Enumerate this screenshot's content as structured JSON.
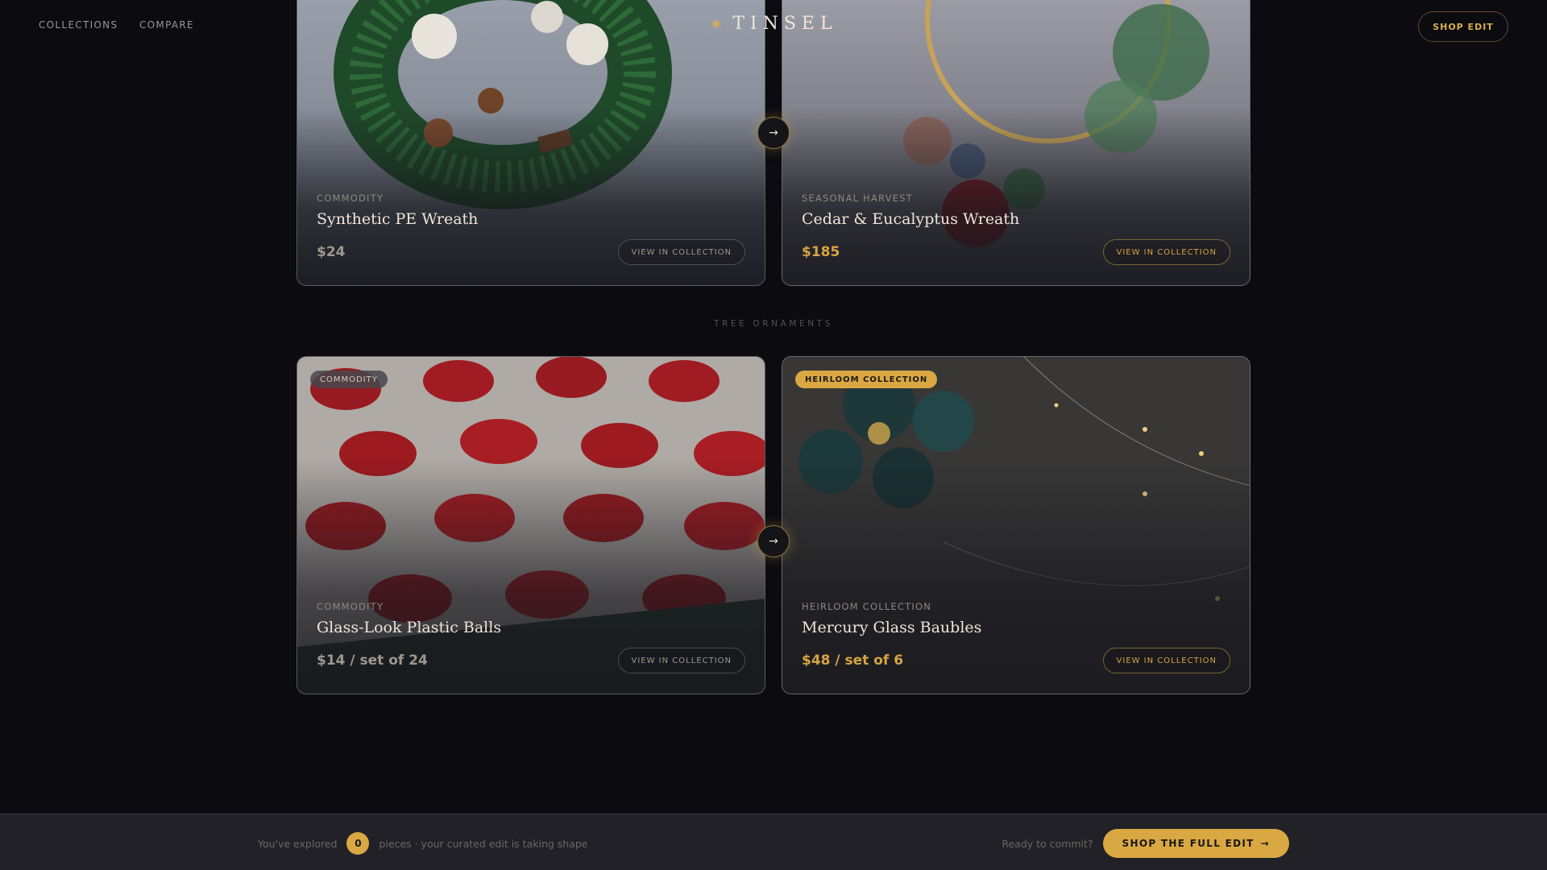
{
  "header": {
    "nav": [
      "COLLECTIONS",
      "COMPARE"
    ],
    "brand_icon": "star-icon",
    "brand_name": "TINSEL",
    "shop_edit_label": "SHOP EDIT",
    "accent_color": "#d9a843"
  },
  "wreaths": {
    "commodity": {
      "category": "COMMODITY",
      "title": "Synthetic PE Wreath",
      "price": "$24",
      "cta": "VIEW IN COLLECTION"
    },
    "heirloom": {
      "category": "SEASONAL HARVEST",
      "title": "Cedar & Eucalyptus Wreath",
      "price": "$185",
      "cta": "VIEW IN COLLECTION"
    },
    "compare_icon": "arrow-right-icon"
  },
  "ornaments": {
    "section_label": "TREE ORNAMENTS",
    "commodity": {
      "badge": "COMMODITY",
      "category": "COMMODITY",
      "title": "Glass-Look Plastic Balls",
      "price": "$14 / set of 24",
      "cta": "VIEW IN COLLECTION"
    },
    "heirloom": {
      "badge": "HEIRLOOM COLLECTION",
      "category": "HEIRLOOM COLLECTION",
      "title": "Mercury Glass Baubles",
      "price": "$48 / set of 6",
      "cta": "VIEW IN COLLECTION"
    },
    "compare_icon": "arrow-right-icon"
  },
  "footer": {
    "explored_prefix": "You've explored",
    "explored_count": "0",
    "explored_suffix": "pieces · your curated edit is taking shape",
    "commit_label": "Ready to commit?",
    "cta": "SHOP THE FULL EDIT",
    "cta_icon": "arrow-right-icon"
  }
}
